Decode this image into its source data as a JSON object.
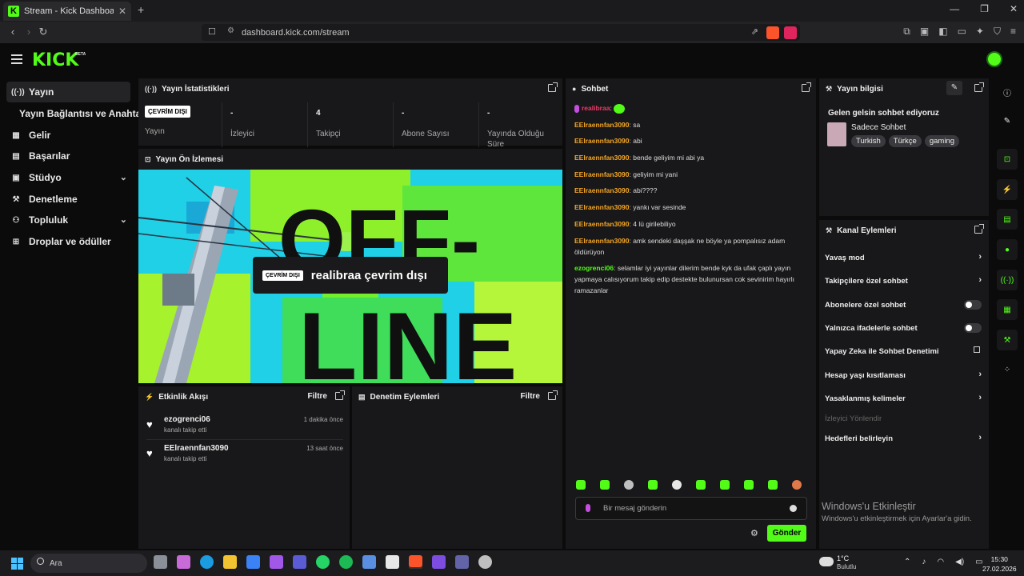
{
  "browser": {
    "tab_title": "Stream - Kick Dashboard",
    "url": "dashboard.kick.com/stream"
  },
  "app": {
    "logo": "KICK",
    "beta": "BETA"
  },
  "sidebar": {
    "items": [
      {
        "label": "Yayın",
        "icon": "broadcast-icon"
      },
      {
        "label": "Yayın Bağlantısı ve Anahtarı",
        "icon": ""
      },
      {
        "label": "Gelir",
        "icon": "revenue-icon"
      },
      {
        "label": "Başarılar",
        "icon": "achievements-icon"
      },
      {
        "label": "Stüdyo",
        "icon": "studio-icon"
      },
      {
        "label": "Denetleme",
        "icon": "wrench-icon"
      },
      {
        "label": "Topluluk",
        "icon": "community-icon"
      },
      {
        "label": "Droplar ve ödüller",
        "icon": "gift-icon"
      }
    ]
  },
  "stats": {
    "title": "Yayın İstatistikleri",
    "items": [
      {
        "value": "ÇEVRİM DIŞI",
        "label": "Yayın"
      },
      {
        "value": "-",
        "label": "İzleyici"
      },
      {
        "value": "4",
        "label": "Takipçi"
      },
      {
        "value": "-",
        "label": "Abone Sayısı"
      },
      {
        "value": "-",
        "label": "Yayında Olduğu Süre"
      }
    ]
  },
  "preview": {
    "title": "Yayın Ön İzlemesi",
    "badge": "ÇEVRİM DIŞI",
    "message": "realibraa çevrim dışı",
    "bg_text_1": "OFF-",
    "bg_text_2": "LINE"
  },
  "activity": {
    "title": "Etkinlik Akışı",
    "filter": "Filtre",
    "rows": [
      {
        "name": "ezogrenci06",
        "sub": "kanalı takip etti",
        "time": "1 dakika önce"
      },
      {
        "name": "EElraennfan3090",
        "sub": "kanalı takip etti",
        "time": "13 saat önce"
      }
    ]
  },
  "moderation": {
    "title": "Denetim Eylemleri",
    "filter": "Filtre"
  },
  "chat": {
    "title": "Sohbet",
    "messages": [
      {
        "user": "realibraa",
        "text": "",
        "type": "owner"
      },
      {
        "user": "EElraennfan3090",
        "text": "sa",
        "type": "user"
      },
      {
        "user": "EElraennfan3090",
        "text": "abi",
        "type": "user"
      },
      {
        "user": "EElraennfan3090",
        "text": "bende geliyim mi abi ya",
        "type": "user"
      },
      {
        "user": "EElraennfan3090",
        "text": "geliyim mi yani",
        "type": "user"
      },
      {
        "user": "EElraennfan3090",
        "text": "abi????",
        "type": "user"
      },
      {
        "user": "EElraennfan3090",
        "text": "yankı var sesinde",
        "type": "user"
      },
      {
        "user": "EElraennfan3090",
        "text": "4 lü girilebiliyo",
        "type": "user"
      },
      {
        "user": "EElraennfan3090",
        "text": "amk sendeki daşşak ne böyle ya pompalısız adam öldürüyon",
        "type": "user"
      },
      {
        "user": "ezogrenci06",
        "text": "selamlar iyi yayınlar dilerim bende kyk da ufak çaplı yayın yapmaya calısıyorum takip edip destekte bulunursan cok sevinirim hayırlı ramazanlar",
        "type": "green"
      }
    ],
    "placeholder": "Bir mesaj gönderin",
    "send": "Gönder"
  },
  "stream_info": {
    "title": "Yayın bilgisi",
    "stream_title": "Gelen gelsin sohbet ediyoruz",
    "category": "Sadece Sohbet",
    "tags": [
      "Turkish",
      "Türkçe",
      "gaming"
    ]
  },
  "channel_actions": {
    "title": "Kanal Eylemleri",
    "rows": [
      {
        "label": "Yavaş mod",
        "kind": "chevron"
      },
      {
        "label": "Takipçilere özel sohbet",
        "kind": "chevron"
      },
      {
        "label": "Abonelere özel sohbet",
        "kind": "toggle"
      },
      {
        "label": "Yalnızca ifadelerle sohbet",
        "kind": "toggle"
      },
      {
        "label": "Yapay Zeka ile Sohbet Denetimi",
        "kind": "external"
      },
      {
        "label": "Hesap yaşı kısıtlaması",
        "kind": "chevron"
      },
      {
        "label": "Yasaklanmış kelimeler",
        "kind": "chevron"
      },
      {
        "label": "İzleyici Yönlendir",
        "kind": "disabled"
      },
      {
        "label": "Hedefleri belirleyin",
        "kind": "chevron"
      }
    ]
  },
  "watermark": {
    "line1": "Windows'u Etkinleştir",
    "line2": "Windows'u etkinleştirmek için Ayarlar'a gidin."
  },
  "taskbar": {
    "search": "Ara",
    "weather_temp": "1°C",
    "weather_desc": "Bulutlu",
    "time": "15:30",
    "date": "27.02.2026"
  },
  "colors": {
    "accent": "#53fc18",
    "panel": "#18181a",
    "bg": "#0b0b0c"
  }
}
